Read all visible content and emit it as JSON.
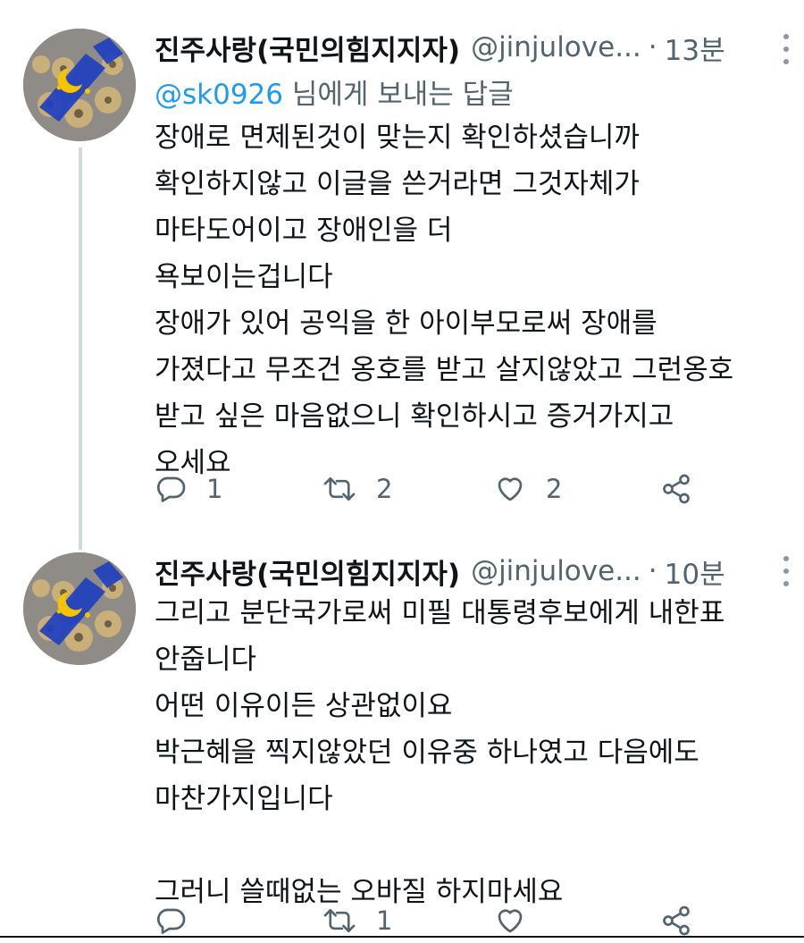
{
  "tweets": [
    {
      "author_name": "진주사랑(국민의힘지지자)",
      "handle": "@jinjulove...",
      "separator": "·",
      "time": "13분",
      "replying_to": {
        "mention": "@sk0926",
        "suffix": " 님에게 보내는 답글"
      },
      "text": "장애로 면제된것이 맞는지 확인하셨습니까\n확인하지않고 이글을 쓴거라면 그것자체가\n마타도어이고 장애인을 더\n욕보이는겁니다\n장애가 있어 공익을 한 아이부모로써 장애를\n가졌다고 무조건 옹호를 받고 살지않았고 그런옹호\n받고 싶은 마음없으니 확인하시고 증거가지고\n오세요",
      "counts": {
        "replies": "1",
        "retweets": "2",
        "likes": "2"
      }
    },
    {
      "author_name": "진주사랑(국민의힘지지자)",
      "handle": "@jinjulove...",
      "separator": "·",
      "time": "10분",
      "text": "그리고 분단국가로써 미필 대통령후보에게 내한표\n안줍니다\n어떤 이유이든 상관없이요\n박근혜을 찍지않았던 이유중 하나였고 다음에도\n마찬가지입니다\n\n그러니 쓸때없는 오바질 하지마세요",
      "counts": {
        "replies": "",
        "retweets": "1",
        "likes": ""
      }
    }
  ],
  "icons": {
    "reply": "reply-icon",
    "retweet": "retweet-icon",
    "like": "heart-icon",
    "share": "share-icon",
    "more": "more-vertical-icon",
    "avatar": "profile-avatar"
  },
  "colors": {
    "text": "#0f1419",
    "secondary": "#536471",
    "accent": "#1d9bf0",
    "thread_line": "#cfd9de",
    "avatar_blue": "#1f3fbf",
    "avatar_yellow": "#f5c400"
  }
}
